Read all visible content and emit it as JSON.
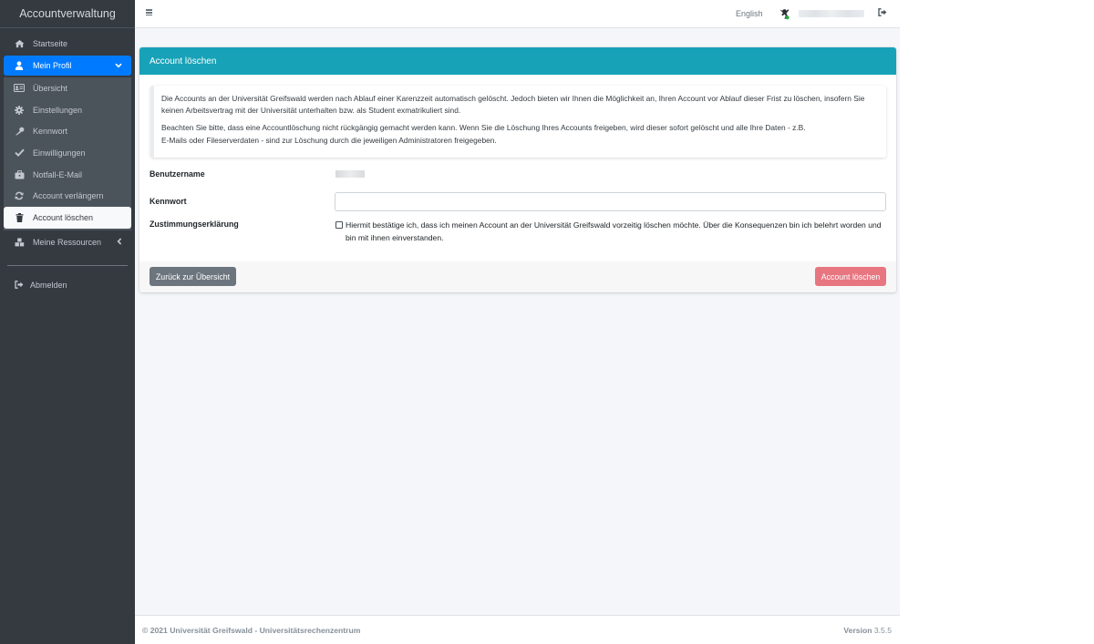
{
  "sidebar": {
    "brand": "Accountverwaltung",
    "items": [
      {
        "label": "Startseite",
        "icon": "home-icon"
      },
      {
        "label": "Mein Profil",
        "icon": "user-icon"
      },
      {
        "label": "Übersicht",
        "icon": "id-card-icon"
      },
      {
        "label": "Einstellungen",
        "icon": "gear-icon"
      },
      {
        "label": "Kennwort",
        "icon": "key-icon"
      },
      {
        "label": "Einwilligungen",
        "icon": "check-icon"
      },
      {
        "label": "Notfall-E-Mail",
        "icon": "briefcase-icon"
      },
      {
        "label": "Account verlängern",
        "icon": "refresh-icon"
      },
      {
        "label": "Account löschen",
        "icon": "trash-icon"
      },
      {
        "label": "Meine Ressourcen",
        "icon": "cubes-icon"
      },
      {
        "label": "Abmelden",
        "icon": "sign-out-icon"
      }
    ]
  },
  "topbar": {
    "language": "English"
  },
  "card": {
    "title": "Account löschen",
    "info_p1": "Die Accounts an der Universität Greifswald werden nach Ablauf einer Karenzzeit automatisch gelöscht. Jedoch bieten wir Ihnen die Möglichkeit an, Ihren Account vor Ablauf dieser Frist zu löschen, insofern Sie keinen Arbeitsvertrag mit der Universität unterhalten bzw. als Student exmatrikuliert sind.",
    "info_p2_line1": "Beachten Sie bitte, dass eine Accountlöschung nicht rückgängig gemacht werden kann. Wenn Sie die Löschung Ihres Accounts freigeben, wird dieser sofort gelöscht und alle Ihre Daten - z.B.",
    "info_p2_line2": "E-Mails oder Fileserverdaten - sind zur Löschung durch die jeweiligen Administratoren freigegeben.",
    "label_username": "Benutzername",
    "label_password": "Kennwort",
    "label_consent": "Zustimmungserklärung",
    "consent_text": "Hiermit bestätige ich, dass ich meinen Account an der Universität Greifswald vorzeitig löschen möchte. Über die Konsequenzen bin ich belehrt worden und bin mit ihnen einverstanden.",
    "btn_back": "Zurück zur Übersicht",
    "btn_delete": "Account löschen"
  },
  "footer": {
    "copyright": "© 2021 Universität Greifswald - Universitätsrechenzentrum",
    "version_label": "Version",
    "version_number": "3.5.5"
  },
  "colors": {
    "sidebar_bg": "#343a40",
    "accent": "#007bff",
    "card_header": "#17a2b8",
    "danger_light": "#e77681",
    "secondary": "#6c757d"
  }
}
